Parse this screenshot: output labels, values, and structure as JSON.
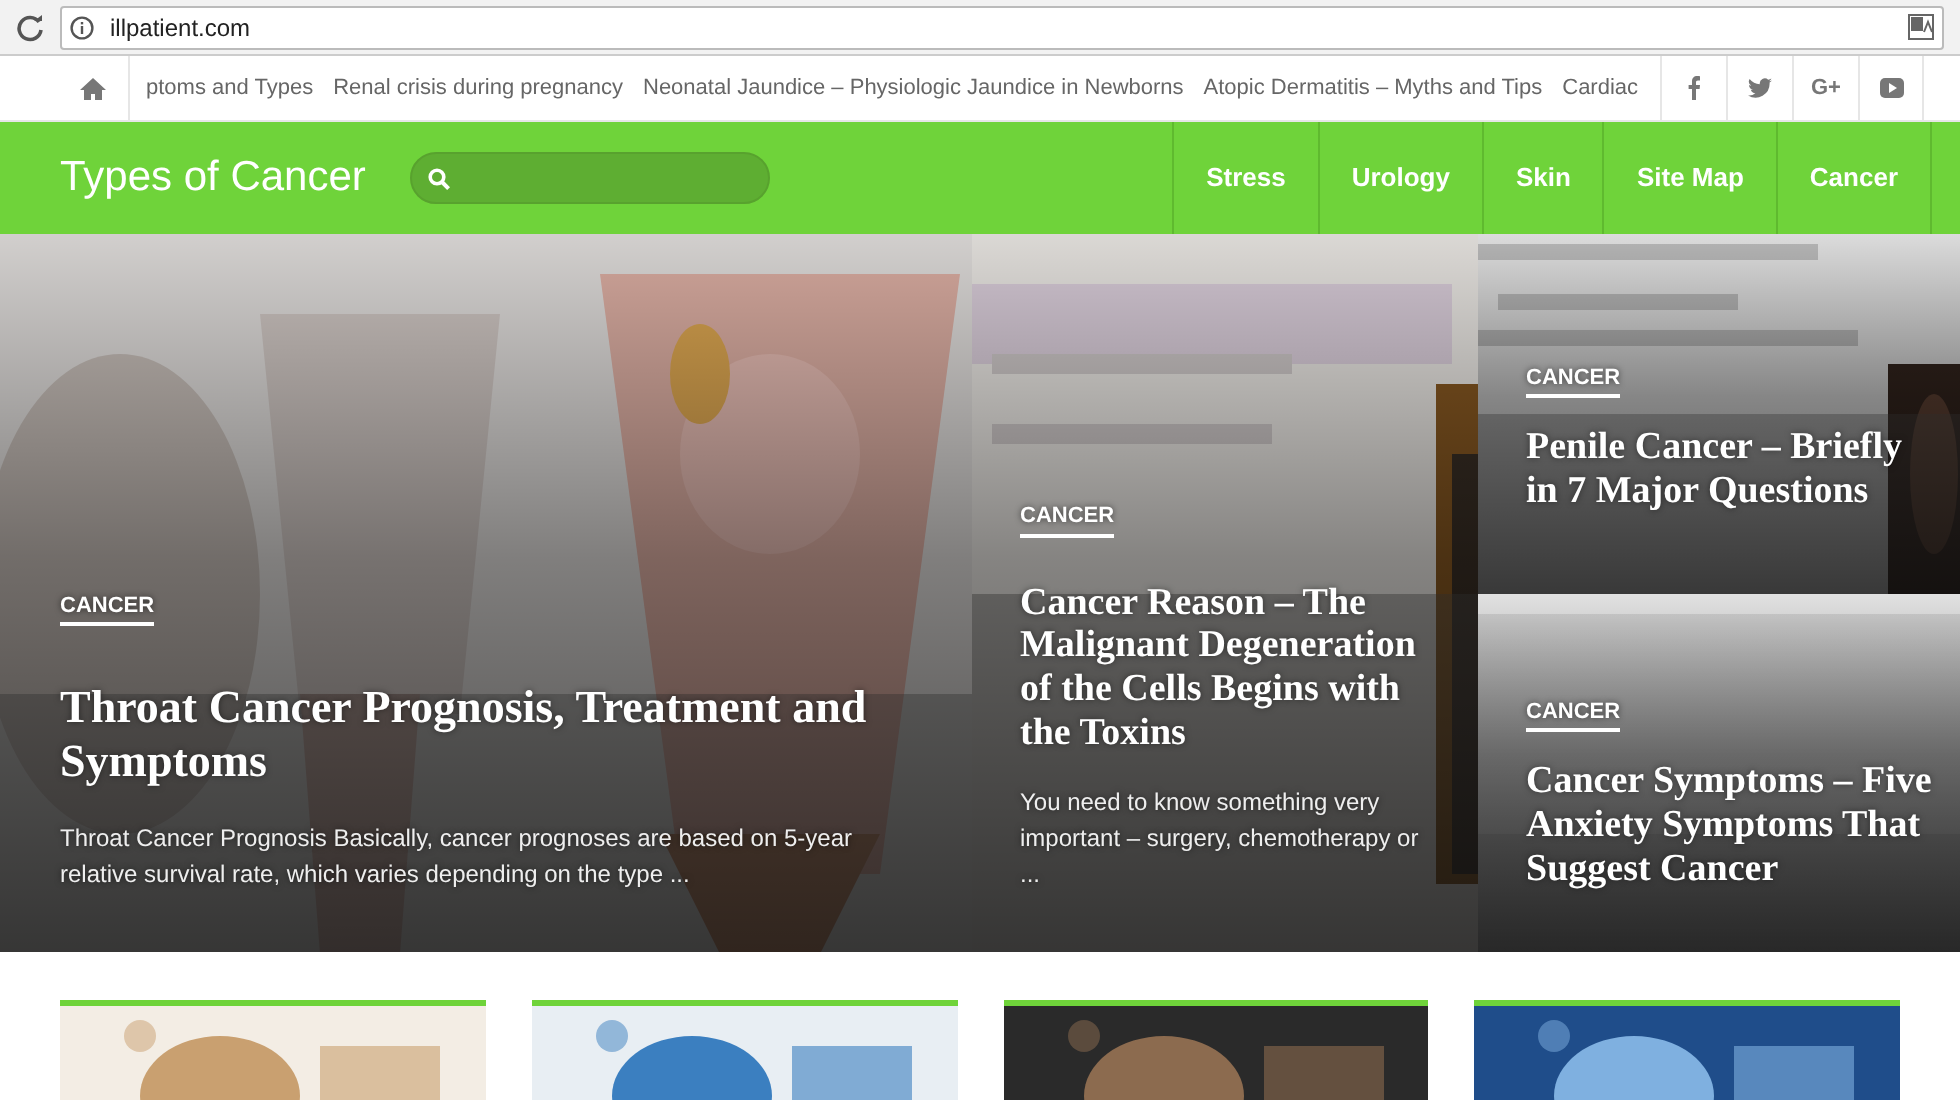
{
  "browser": {
    "url": "illpatient.com"
  },
  "ticker": {
    "items": [
      "ptoms and Types",
      "Renal crisis during pregnancy",
      "Neonatal Jaundice – Physiologic Jaundice in Newborns",
      "Atopic Dermatitis – Myths and Tips",
      "Cardiac"
    ],
    "social": [
      {
        "kind": "facebook"
      },
      {
        "kind": "twitter"
      },
      {
        "kind": "text",
        "label": "G+"
      },
      {
        "kind": "youtube"
      }
    ]
  },
  "header": {
    "logo": "Types of Cancer",
    "menu": [
      "Stress",
      "Urology",
      "Skin",
      "Site Map",
      "Cancer"
    ]
  },
  "featured": [
    {
      "kind": "large",
      "category": "CANCER",
      "title": "Throat Cancer Prognosis, Treatment and Symptoms",
      "excerpt": "Throat Cancer Prognosis Basically, cancer prognoses are based on 5-year relative survival rate, which varies depending on the type ..."
    },
    {
      "kind": "tall",
      "category": "CANCER",
      "title": "Cancer Reason – The Malignant Degeneration of the Cells Begins with the Toxins",
      "excerpt": "You need to know something very important – surgery, chemotherapy or ..."
    },
    {
      "kind": "small",
      "category": "CANCER",
      "title": "Penile Cancer – Briefly in 7 Major Questions"
    },
    {
      "kind": "small",
      "category": "CANCER",
      "title": "Cancer Symptoms – Five Anxiety Symptoms That Suggest Cancer"
    }
  ]
}
